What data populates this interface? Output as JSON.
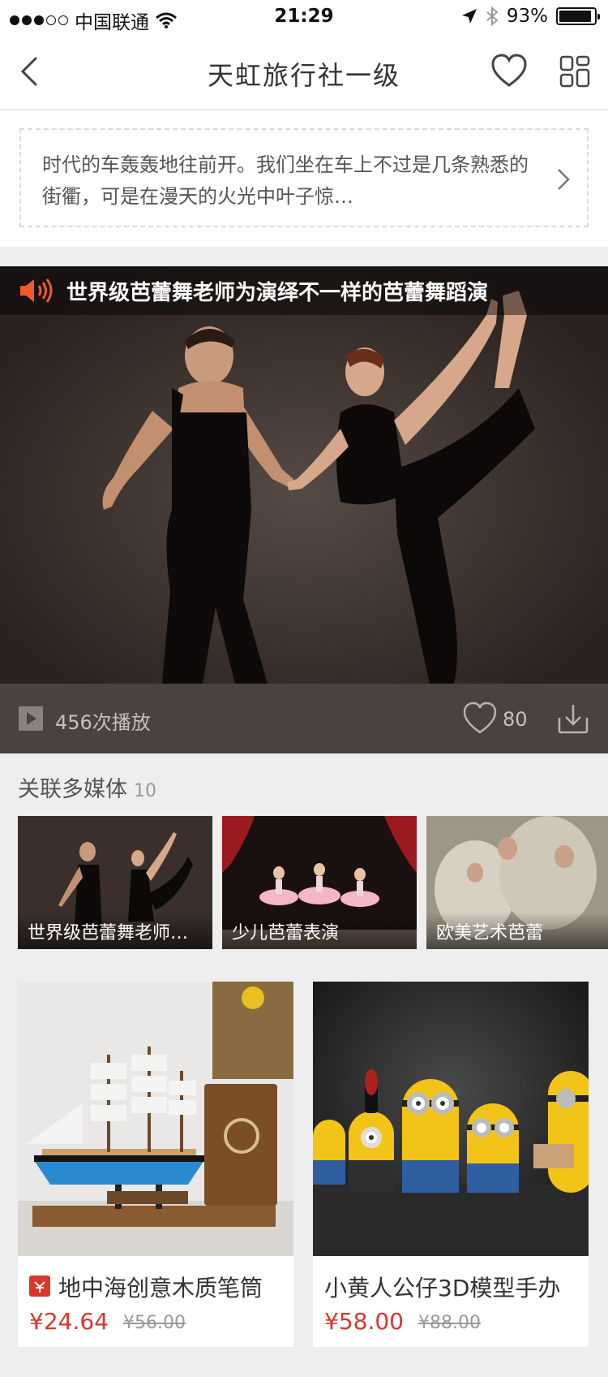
{
  "status": {
    "carrier": "中国联通",
    "time": "21:29",
    "battery": "93%",
    "battery_level": 0.93
  },
  "nav": {
    "title": "天虹旅行社一级"
  },
  "intro": {
    "text": "时代的车轰轰地往前开。我们坐在车上不过是几条熟悉的街衢，可是在漫天的火光中叶子惊…"
  },
  "media": {
    "caption": "世界级芭蕾舞老师为演绎不一样的芭蕾舞蹈演",
    "plays": "456次播放",
    "likes": "80"
  },
  "related": {
    "title": "关联多媒体",
    "count": "10",
    "items": [
      {
        "label": "世界级芭蕾舞老师为演绎不一样的芭蕾舞蹈演"
      },
      {
        "label": "少儿芭蕾表演"
      },
      {
        "label": "欧美艺术芭蕾"
      }
    ]
  },
  "products": [
    {
      "title": "地中海创意木质笔筒",
      "price": "¥24.64",
      "old_price": "¥56.00"
    },
    {
      "title": "小黄人公仔3D模型手办",
      "price": "¥58.00",
      "old_price": "¥88.00"
    }
  ],
  "colors": {
    "accent": "#d9362c",
    "speaker": "#f05a28"
  }
}
